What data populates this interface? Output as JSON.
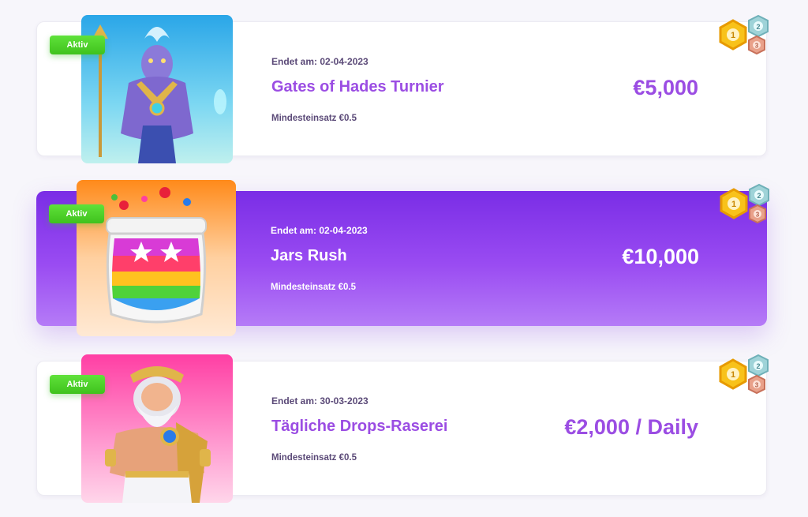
{
  "tournaments": [
    {
      "status": "Aktiv",
      "ends_at": "Endet am: 02-04-2023",
      "title": "Gates of Hades Turnier",
      "min_bet": "Mindesteinsatz €0.5",
      "prize": "€5,000",
      "thumbnail": "hades-warrior-artwork",
      "active": false
    },
    {
      "status": "Aktiv",
      "ends_at": "Endet am: 02-04-2023",
      "title": "Jars Rush",
      "min_bet": "Mindesteinsatz €0.5",
      "prize": "€10,000",
      "thumbnail": "rainbow-jar-artwork",
      "active": true
    },
    {
      "status": "Aktiv",
      "ends_at": "Endet am: 30-03-2023",
      "title": "Tägliche Drops-Raserei",
      "min_bet": "Mindesteinsatz €0.5",
      "prize": "€2,000 / Daily",
      "thumbnail": "zeus-artwork",
      "active": false
    }
  ],
  "medal_labels": [
    "1",
    "2",
    "3"
  ],
  "colors": {
    "accent_purple": "#9b4de3",
    "active_gradient_start": "#7a2de6",
    "active_gradient_end": "#b57bf7",
    "badge_green": "#4fd22b",
    "gold": "#f5b400",
    "silver": "#8fc3c9",
    "bronze": "#d9846a"
  }
}
